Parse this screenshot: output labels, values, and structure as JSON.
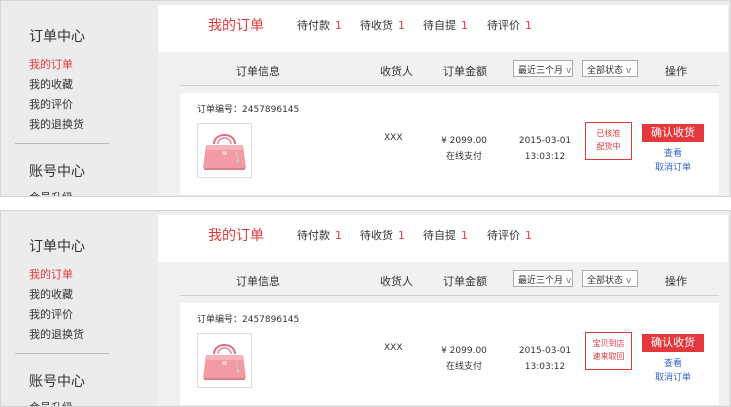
{
  "panels": [
    {
      "sidebar": {
        "section1_title": "订单中心",
        "items": [
          "我的订单",
          "我的收藏",
          "我的评价",
          "我的退换货"
        ],
        "section2_title": "账号中心",
        "partial_item": "会员升级"
      },
      "tabs": {
        "main": "我的订单",
        "items": [
          {
            "label": "待付款",
            "count": "1"
          },
          {
            "label": "待收货",
            "count": "1"
          },
          {
            "label": "待自提",
            "count": "1"
          },
          {
            "label": "待评价",
            "count": "1"
          }
        ]
      },
      "table": {
        "headers": {
          "info": "订单信息",
          "buyer": "收货人",
          "amount": "订单金额",
          "action": "操作"
        },
        "time_filter": "最近三个月",
        "status_filter": "全部状态",
        "arrow": "v"
      },
      "order": {
        "order_no": "订单编号：2457896145",
        "buyer": "XXX",
        "price": "¥ 2099.00",
        "pay_method": "在线支付",
        "date": "2015-03-01",
        "time": "13:03:12",
        "status_line1": "已核准",
        "status_line2": "配货中",
        "confirm_label": "确认收货",
        "view_label": "查看",
        "cancel_label": "取消订单"
      }
    },
    {
      "sidebar": {
        "section1_title": "订单中心",
        "items": [
          "我的订单",
          "我的收藏",
          "我的评价",
          "我的退换货"
        ],
        "section2_title": "账号中心",
        "partial_item": "会员升级"
      },
      "tabs": {
        "main": "我的订单",
        "items": [
          {
            "label": "待付款",
            "count": "1"
          },
          {
            "label": "待收货",
            "count": "1"
          },
          {
            "label": "待自提",
            "count": "1"
          },
          {
            "label": "待评价",
            "count": "1"
          }
        ]
      },
      "table": {
        "headers": {
          "info": "订单信息",
          "buyer": "收货人",
          "amount": "订单金额",
          "action": "操作"
        },
        "time_filter": "最近三个月",
        "status_filter": "全部状态",
        "arrow": "v"
      },
      "order": {
        "order_no": "订单编号：2457896145",
        "buyer": "XXX",
        "price": "¥ 2099.00",
        "pay_method": "在线支付",
        "date": "2015-03-01",
        "time": "13:03:12",
        "status_line1": "宝贝到店",
        "status_line2": "速来取回",
        "confirm_label": "确认收货",
        "view_label": "查看",
        "cancel_label": "取消订单"
      }
    }
  ],
  "colors": {
    "accent": "#e4393c",
    "link": "#3366cc",
    "background": "#ececec"
  },
  "icons": {
    "product_image": "pink-handbag-image",
    "dropdown": "chevron-down-icon"
  }
}
